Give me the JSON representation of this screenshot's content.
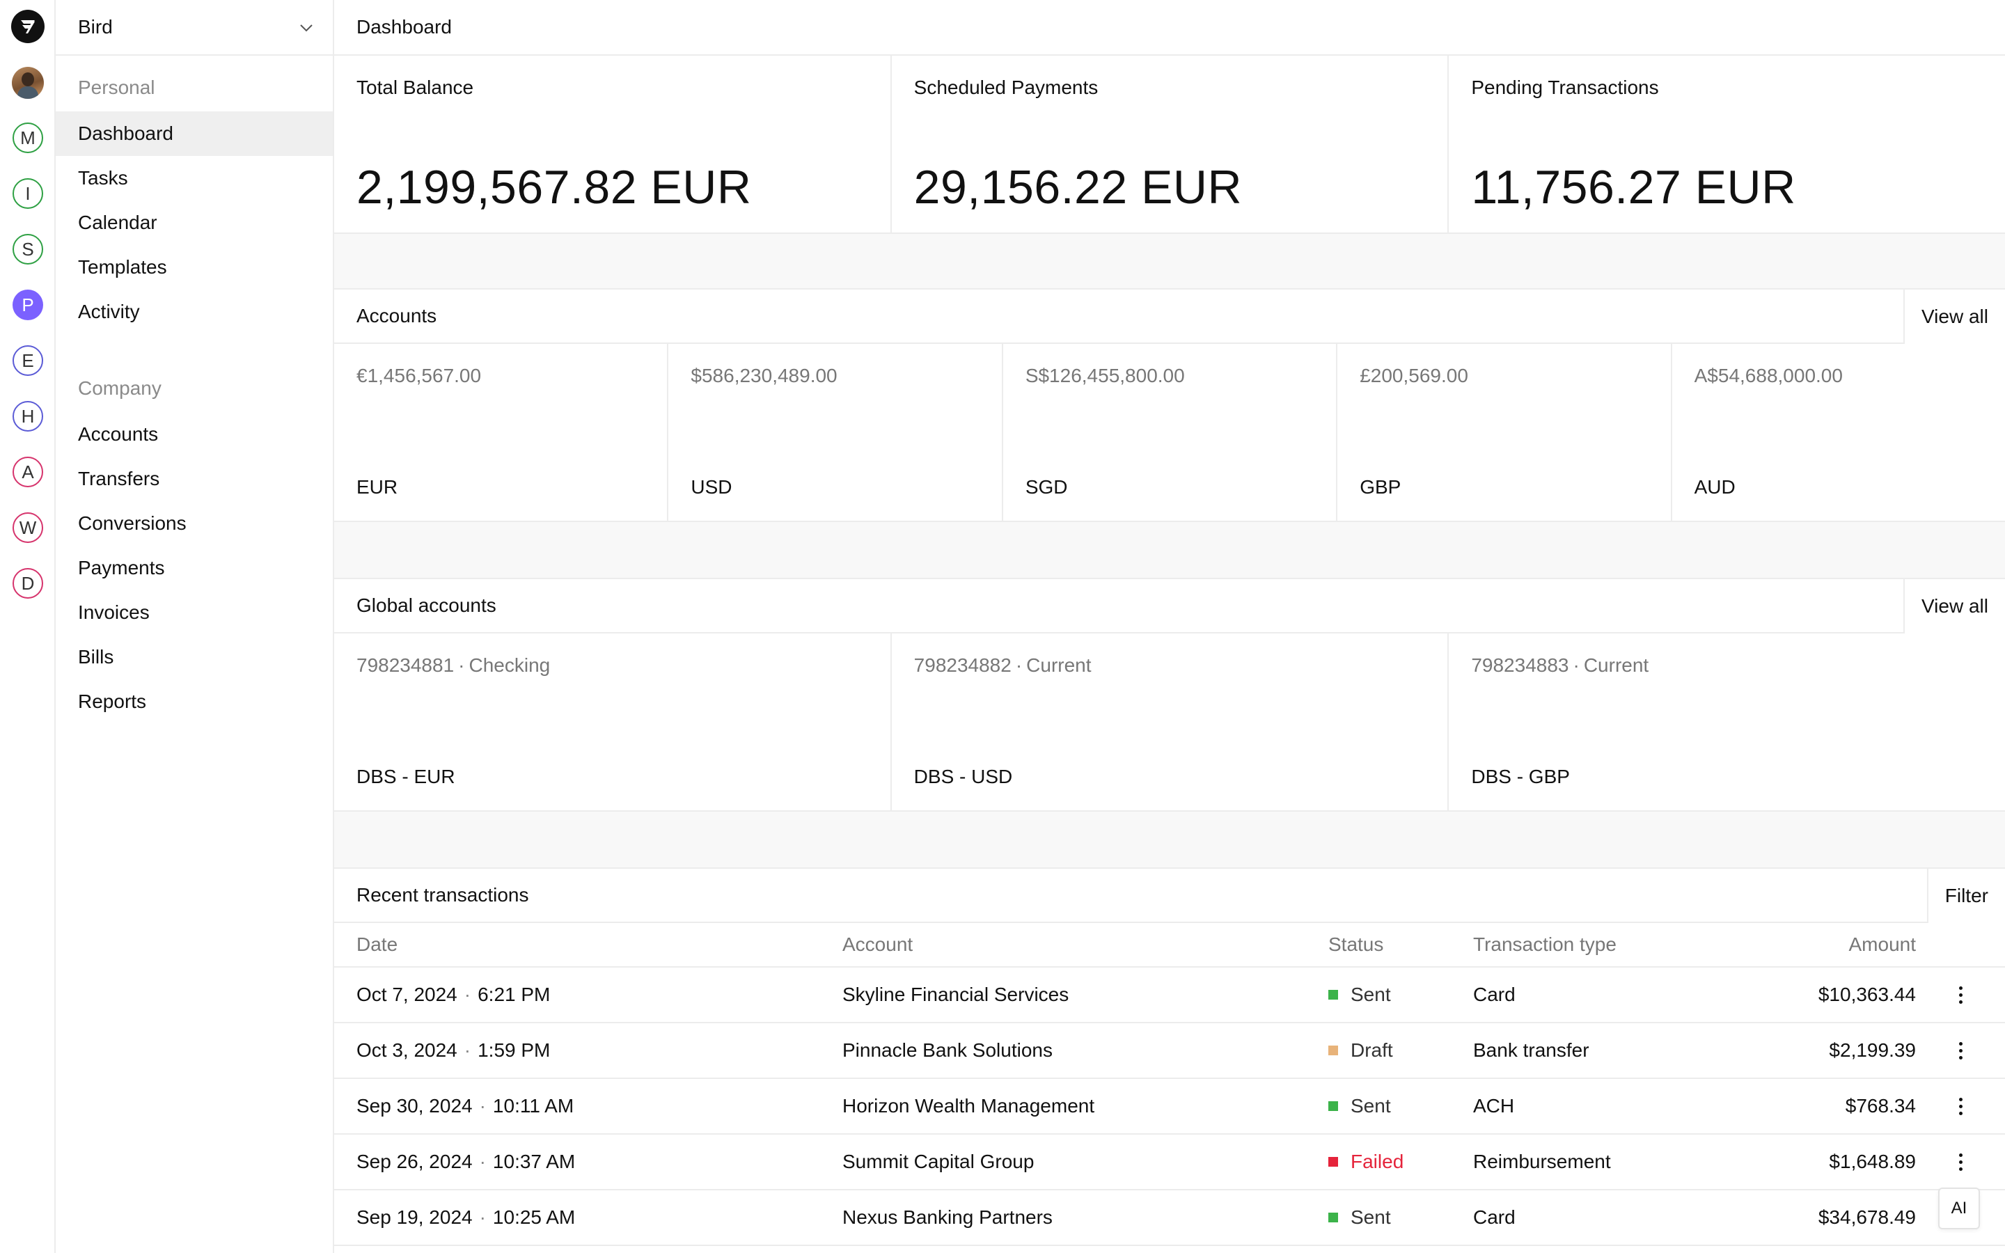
{
  "org": {
    "name": "Bird"
  },
  "workspaces": [
    {
      "letter": "M",
      "color": "#2ea043",
      "filled": false
    },
    {
      "letter": "I",
      "color": "#2ea043",
      "filled": false
    },
    {
      "letter": "S",
      "color": "#2ea043",
      "filled": false
    },
    {
      "letter": "P",
      "color": "#7b61ff",
      "filled": true
    },
    {
      "letter": "E",
      "color": "#5b5bd6",
      "filled": false
    },
    {
      "letter": "H",
      "color": "#5b5bd6",
      "filled": false
    },
    {
      "letter": "A",
      "color": "#d6336c",
      "filled": false
    },
    {
      "letter": "W",
      "color": "#d6336c",
      "filled": false
    },
    {
      "letter": "D",
      "color": "#d6336c",
      "filled": false
    }
  ],
  "sidebar": {
    "personal_label": "Personal",
    "personal_items": [
      "Dashboard",
      "Tasks",
      "Calendar",
      "Templates",
      "Activity"
    ],
    "company_label": "Company",
    "company_items": [
      "Accounts",
      "Transfers",
      "Conversions",
      "Payments",
      "Invoices",
      "Bills",
      "Reports"
    ]
  },
  "header": {
    "title": "Dashboard"
  },
  "stats": [
    {
      "label": "Total Balance",
      "value": "2,199,567.82 EUR"
    },
    {
      "label": "Scheduled Payments",
      "value": "29,156.22 EUR"
    },
    {
      "label": "Pending Transactions",
      "value": "11,756.27 EUR"
    }
  ],
  "accounts": {
    "title": "Accounts",
    "view_all": "View all",
    "items": [
      {
        "amount": "€1,456,567.00",
        "currency": "EUR"
      },
      {
        "amount": "$586,230,489.00",
        "currency": "USD"
      },
      {
        "amount": "S$126,455,800.00",
        "currency": "SGD"
      },
      {
        "amount": "£200,569.00",
        "currency": "GBP"
      },
      {
        "amount": "A$54,688,000.00",
        "currency": "AUD"
      }
    ]
  },
  "global_accounts": {
    "title": "Global accounts",
    "view_all": "View all",
    "items": [
      {
        "number": "798234881",
        "kind": "Checking",
        "name": "DBS - EUR"
      },
      {
        "number": "798234882",
        "kind": "Current",
        "name": "DBS - USD"
      },
      {
        "number": "798234883",
        "kind": "Current",
        "name": "DBS - GBP"
      }
    ]
  },
  "transactions": {
    "title": "Recent transactions",
    "filter": "Filter",
    "columns": {
      "date": "Date",
      "account": "Account",
      "status": "Status",
      "type": "Transaction type",
      "amount": "Amount"
    },
    "rows": [
      {
        "date": "Oct 7, 2024",
        "time": "6:21 PM",
        "account": "Skyline Financial Services",
        "status": "Sent",
        "status_color": "#3cb34a",
        "type": "Card",
        "amount": "$10,363.44"
      },
      {
        "date": "Oct 3, 2024",
        "time": "1:59 PM",
        "account": "Pinnacle Bank Solutions",
        "status": "Draft",
        "status_color": "#e8b37a",
        "type": "Bank transfer",
        "amount": "$2,199.39"
      },
      {
        "date": "Sep 30, 2024",
        "time": "10:11 AM",
        "account": "Horizon Wealth Management",
        "status": "Sent",
        "status_color": "#3cb34a",
        "type": "ACH",
        "amount": "$768.34"
      },
      {
        "date": "Sep 26, 2024",
        "time": "10:37 AM",
        "account": "Summit Capital Group",
        "status": "Failed",
        "status_color": "#e5243b",
        "type": "Reimbursement",
        "amount": "$1,648.89"
      },
      {
        "date": "Sep 19, 2024",
        "time": "10:25 AM",
        "account": "Nexus Banking Partners",
        "status": "Sent",
        "status_color": "#3cb34a",
        "type": "Card",
        "amount": "$34,678.49"
      }
    ]
  },
  "assistant": {
    "label": "AI"
  }
}
